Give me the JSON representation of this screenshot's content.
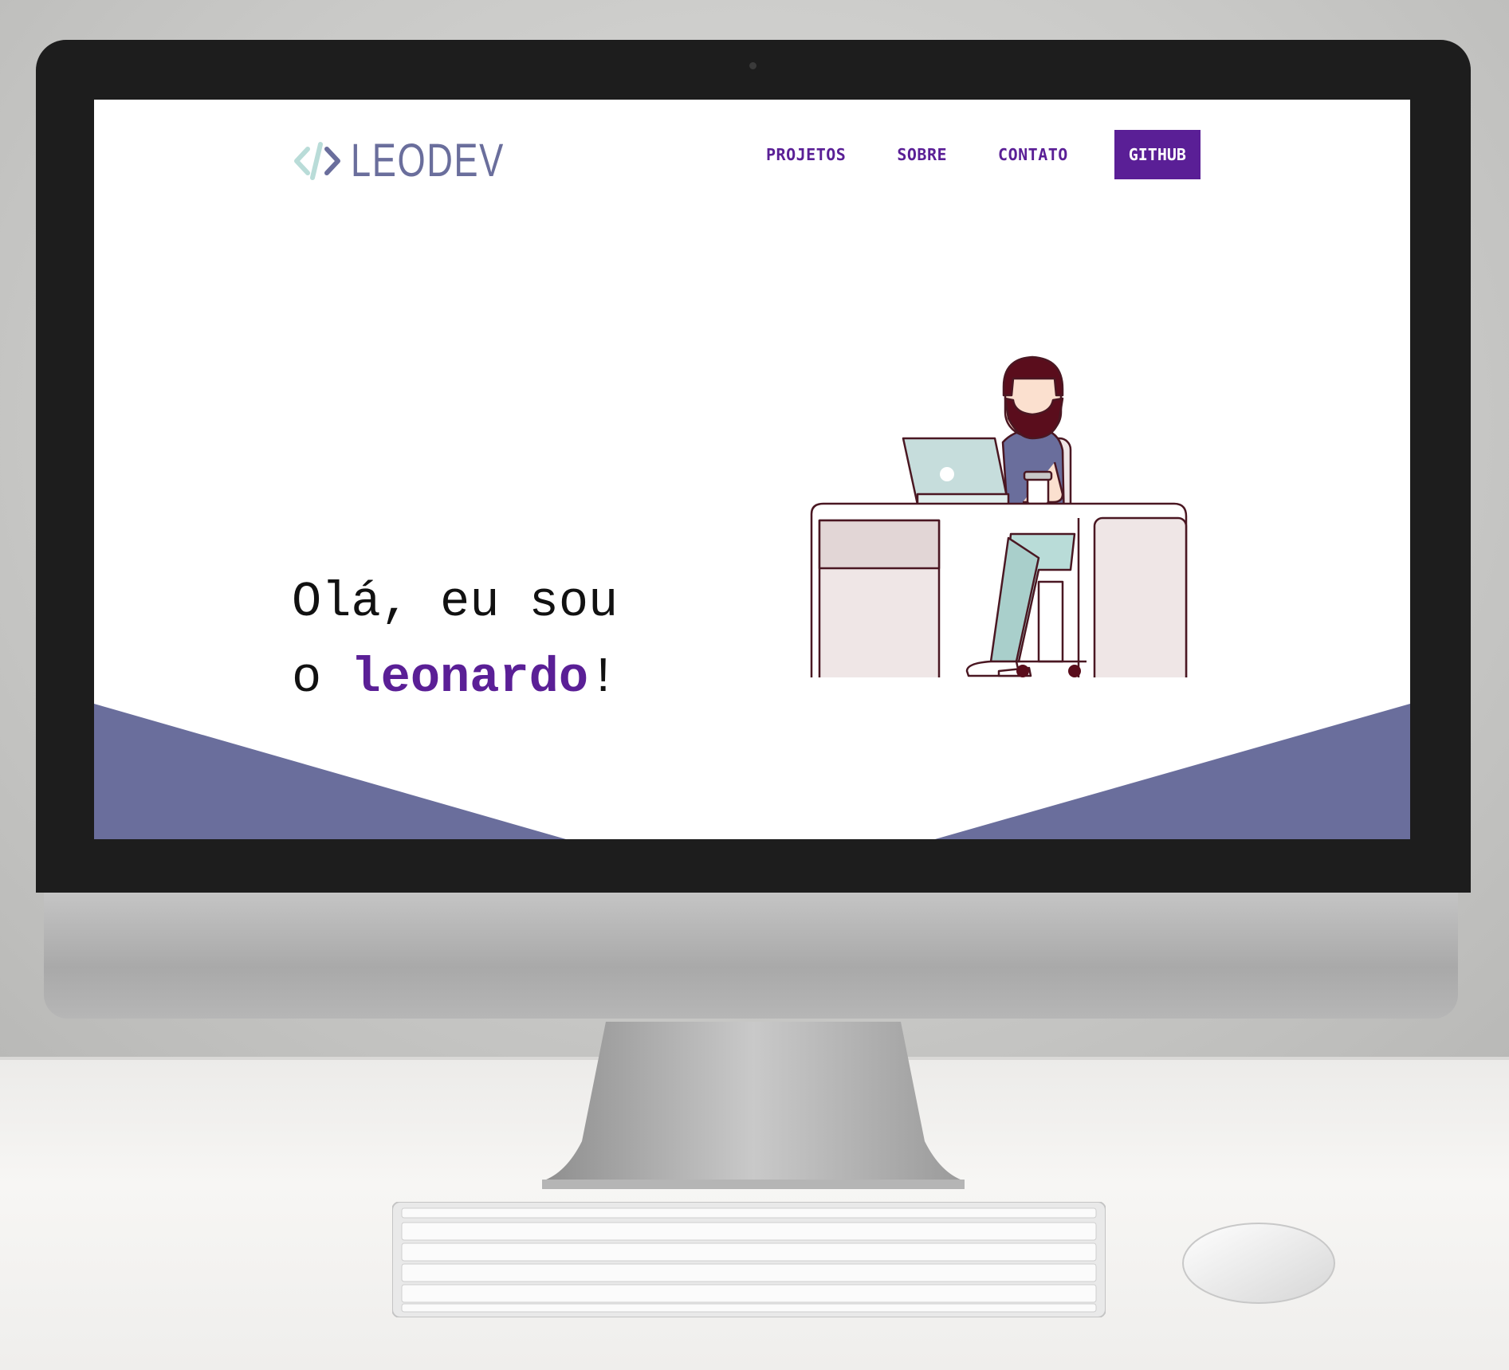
{
  "site": {
    "logo": {
      "mark": "</>",
      "text": "LEODEV"
    },
    "nav": {
      "items": [
        {
          "label": "PROJETOS"
        },
        {
          "label": "SOBRE"
        },
        {
          "label": "CONTATO"
        }
      ],
      "cta_label": "GITHUB"
    },
    "hero": {
      "line1": "Olá, eu sou",
      "line2_prefix": "o ",
      "name": "leonardo",
      "line2_suffix": "!"
    },
    "illustration": "developer-at-desk-illustration"
  },
  "colors": {
    "accent_purple": "#5a1f96",
    "slate_blue": "#6a6e9c",
    "mint": "#b9dcd8",
    "screen_bg": "#ffffff"
  },
  "scene": {
    "device": "desktop-monitor-mockup",
    "keyboard_icon": "keyboard-icon",
    "mouse_icon": "mouse-icon"
  }
}
